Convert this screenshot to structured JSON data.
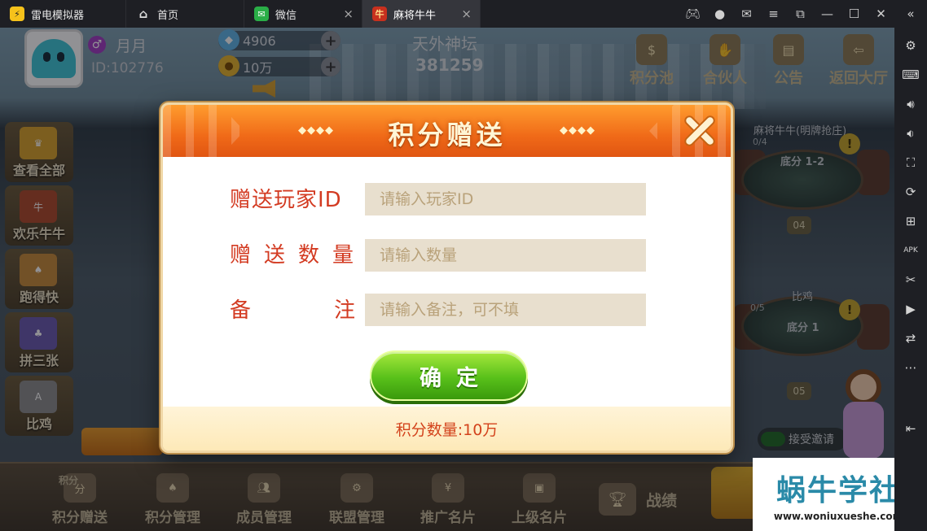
{
  "titlebar": {
    "app_name": "雷电模拟器",
    "tabs": [
      {
        "label": "首页"
      },
      {
        "label": "微信"
      },
      {
        "label": "麻将牛牛"
      }
    ]
  },
  "player": {
    "name": "月月",
    "id_text": "ID:102776",
    "diamonds": "4906",
    "gold": "10万"
  },
  "club": {
    "name": "天外神坛",
    "id": "381259"
  },
  "top_buttons": [
    {
      "label": "积分池"
    },
    {
      "label": "合伙人"
    },
    {
      "label": "公告"
    },
    {
      "label": "返回大厅"
    }
  ],
  "left_games": [
    {
      "label": "查看全部"
    },
    {
      "label": "欢乐牛牛"
    },
    {
      "label": "跑得快"
    },
    {
      "label": "拼三张"
    },
    {
      "label": "比鸡"
    }
  ],
  "tables": [
    {
      "name": "麻将牛牛(明牌抢庄)",
      "count": "0/4",
      "base": "底分 1-2",
      "number": "04"
    },
    {
      "name": "比鸡",
      "count": "0/5",
      "base": "底分 1",
      "number": "05"
    }
  ],
  "accept_invite": "接受邀请",
  "bottom_nav": [
    {
      "top": "积分",
      "label": "积分赠送"
    },
    {
      "label": "积分管理"
    },
    {
      "label": "成员管理"
    },
    {
      "label": "联盟管理"
    },
    {
      "label": "推广名片"
    },
    {
      "label": "上级名片"
    }
  ],
  "record_label": "战绩",
  "watermark": {
    "title": "蜗牛学社",
    "url": "www.woniuxueshe.com"
  },
  "modal": {
    "title": "积分赠送",
    "deco_left": "◆◆◆◆",
    "deco_right": "◆◆◆◆",
    "fields": {
      "player_id_label": "赠送玩家ID",
      "player_id_placeholder": "请输入玩家ID",
      "quantity_label": "赠送数量",
      "quantity_placeholder": "请输入数量",
      "note_label_1": "备",
      "note_label_2": "注",
      "note_placeholder": "请输入备注，可不填"
    },
    "confirm_label": "确定",
    "footer": "积分数量:10万"
  },
  "colors": {
    "modal_header": "#f06a18",
    "label_red": "#d33b22",
    "confirm_green": "#58c01a",
    "input_bg": "#e8dfce"
  }
}
